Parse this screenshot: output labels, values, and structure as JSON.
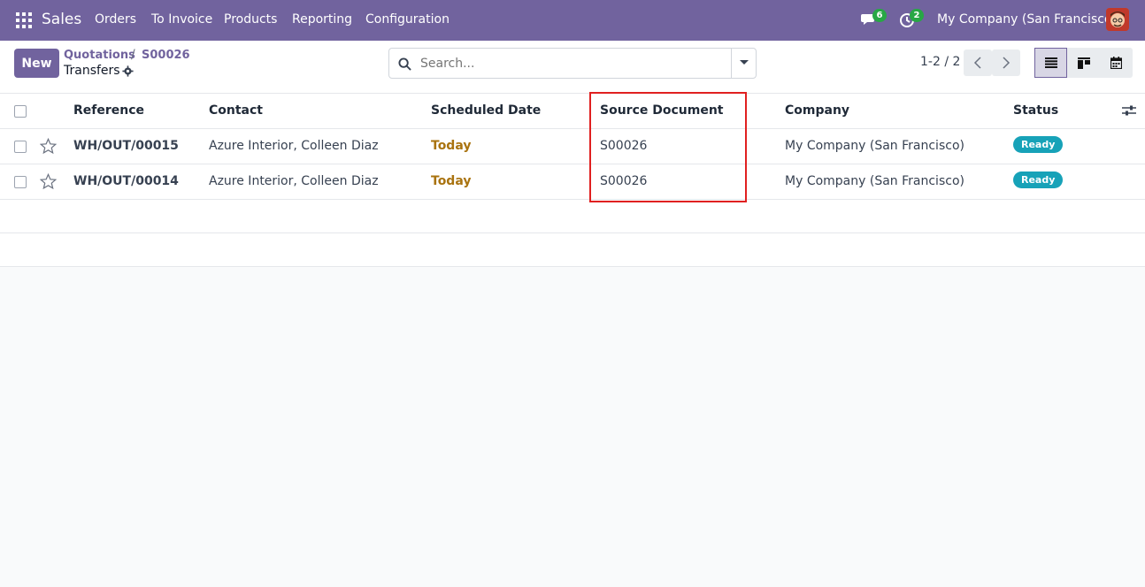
{
  "navbar": {
    "brand": "Sales",
    "items": [
      "Orders",
      "To Invoice",
      "Products",
      "Reporting",
      "Configuration"
    ],
    "chat_count": "6",
    "activity_count": "2",
    "company": "My Company (San Francisco)"
  },
  "control": {
    "new_label": "New",
    "breadcrumb": [
      "Quotations",
      "S00026"
    ],
    "current": "Transfers",
    "search_placeholder": "Search...",
    "pager": "1-2 / 2"
  },
  "table": {
    "headers": [
      "Reference",
      "Contact",
      "Scheduled Date",
      "Source Document",
      "Company",
      "Status"
    ],
    "rows": [
      {
        "reference": "WH/OUT/00015",
        "contact": "Azure Interior, Colleen Diaz",
        "scheduled": "Today",
        "source": "S00026",
        "company": "My Company (San Francisco)",
        "status": "Ready"
      },
      {
        "reference": "WH/OUT/00014",
        "contact": "Azure Interior, Colleen Diaz",
        "scheduled": "Today",
        "source": "S00026",
        "company": "My Company (San Francisco)",
        "status": "Ready"
      }
    ]
  },
  "colors": {
    "brand": "#71639e",
    "status_ready": "#17a2b8",
    "today": "#a9730f",
    "highlight": "#e02020"
  }
}
